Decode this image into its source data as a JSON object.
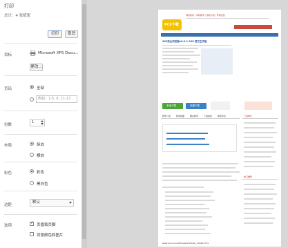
{
  "dialog": {
    "title": "打印",
    "total": "总计：4 张纸张",
    "print_button": "打印",
    "cancel_button": "取消"
  },
  "destination": {
    "label": "目标",
    "printer": "Microsoft XPS Docu...",
    "change_button": "更改..."
  },
  "pages": {
    "label": "页码",
    "all": "全部",
    "range_placeholder": "例如：1-5, 8, 11-13"
  },
  "copies": {
    "label": "份数",
    "value": "1"
  },
  "layout": {
    "label": "布局",
    "portrait": "纵向",
    "landscape": "横向"
  },
  "color": {
    "label": "彩色",
    "color": "彩色",
    "bw": "黑白色"
  },
  "margins": {
    "label": "边距",
    "value": "默认"
  },
  "options": {
    "label": "选项",
    "headers_footers": "页眉和页脚",
    "background_graphics": "背景颜色和图片"
  },
  "preview": {
    "site_logo": "PC6下载",
    "header_line": "绿色软件 | 手机软件 | 游戏下载 | 专题合集",
    "product_title": "360安全浏览器v8.0.1.348 官方正式版",
    "download_btn_1": "本地下载",
    "download_btn_2": "迅雷下载",
    "tabs": [
      "软件介绍",
      "软件截图",
      "相关软件",
      "下载地址",
      "网友评论"
    ],
    "sidebar_title": "下载排行",
    "related_title": "热门推荐",
    "footer_url": "www.pc6.com/softview/SoftView_40424.html"
  },
  "colors": {
    "download_green": "#4aa63a",
    "download_blue": "#3b82c4",
    "logo_yellow": "#f2c200",
    "accent_red": "#e54b3a"
  }
}
